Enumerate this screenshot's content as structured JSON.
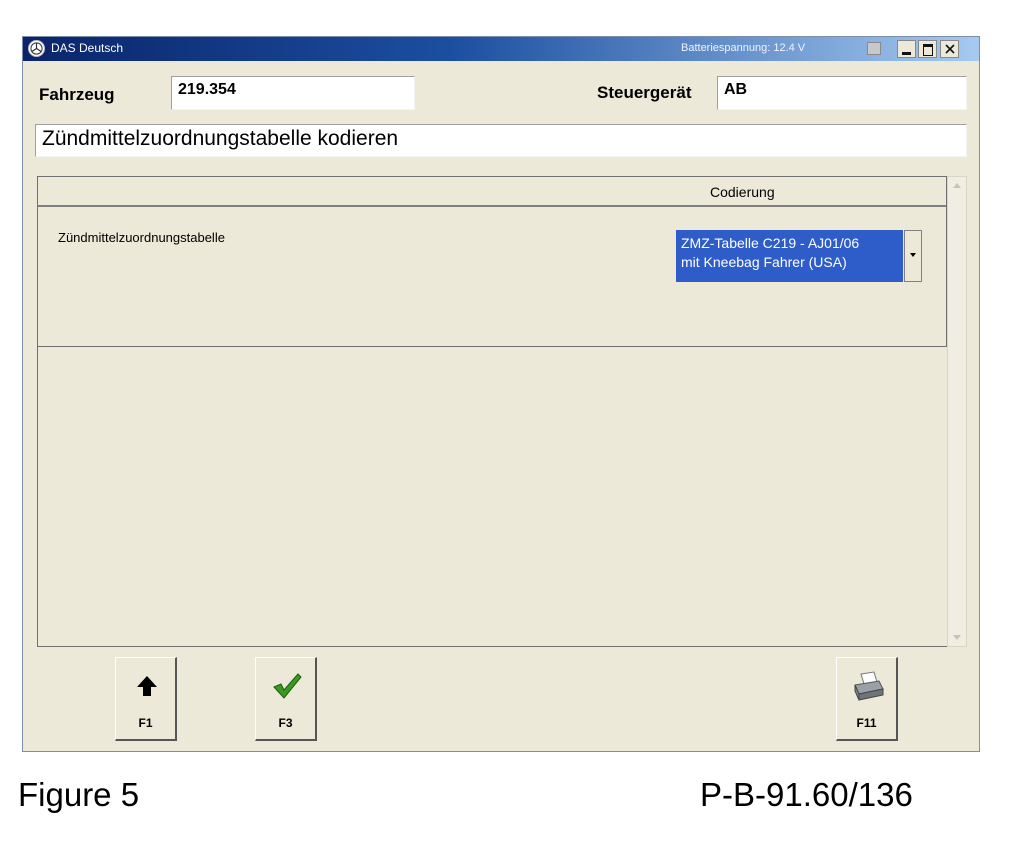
{
  "window": {
    "title": "DAS Deutsch",
    "battery_status": "Batteriespannung: 12.4 V"
  },
  "fields": {
    "fahrzeug_label": "Fahrzeug",
    "fahrzeug_value": "219.354",
    "steuergeraet_label": "Steuergerät",
    "steuergeraet_value": "AB"
  },
  "heading": "Zündmittelzuordnungstabelle kodieren",
  "table": {
    "column_header": "Codierung",
    "row_label": "Zündmittelzuordnungstabelle",
    "selected_value_line1": "ZMZ-Tabelle C219 - AJ01/06",
    "selected_value_line2": "mit Kneebag Fahrer (USA)"
  },
  "function_keys": [
    {
      "label": "F1",
      "icon": "arrow-up-icon"
    },
    {
      "label": "F3",
      "icon": "checkmark-icon"
    },
    {
      "label": "F11",
      "icon": "printer-icon"
    }
  ],
  "colors": {
    "selection": "#2e5cc8",
    "checkmark": "#3a9a20",
    "titlebar": "#0a246a"
  },
  "figure": {
    "caption": "Figure 5",
    "reference": "P-B-91.60/136"
  }
}
